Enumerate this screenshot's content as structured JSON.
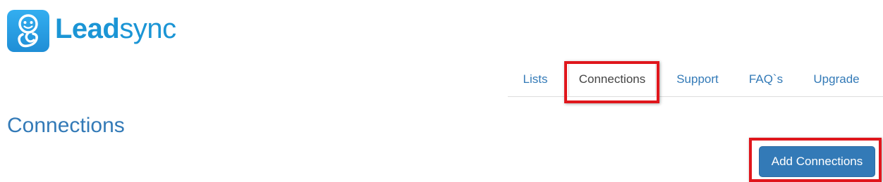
{
  "brand": {
    "name_bold": "Lead",
    "name_light": "sync",
    "color": "#1b95d5",
    "icon": "baby-face-icon"
  },
  "nav": {
    "tabs": [
      {
        "label": "Lists",
        "active": false
      },
      {
        "label": "Connections",
        "active": true
      },
      {
        "label": "Support",
        "active": false
      },
      {
        "label": "FAQ`s",
        "active": false
      },
      {
        "label": "Upgrade",
        "active": false
      }
    ],
    "link_color": "#337ab7"
  },
  "main": {
    "title": "Connections",
    "add_button_label": "Add Connections",
    "button_color": "#337ab7"
  },
  "annotations": {
    "highlight_color": "#e0161c"
  }
}
